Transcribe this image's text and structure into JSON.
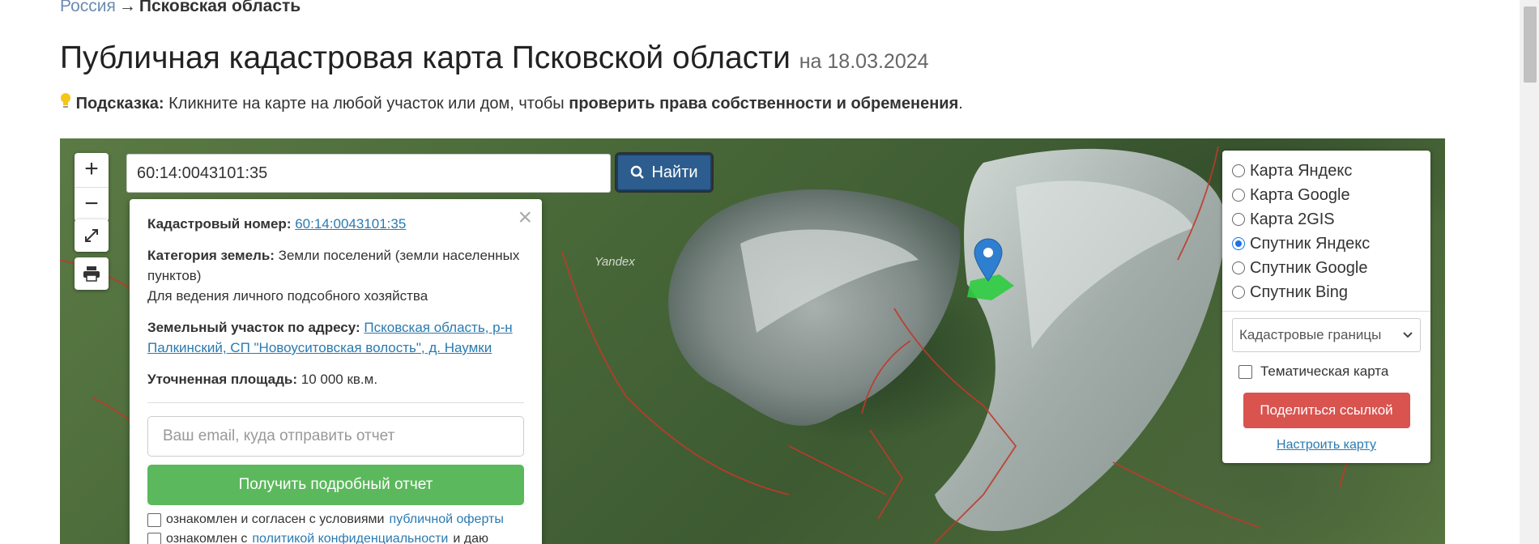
{
  "breadcrumb": {
    "parent": "Россия",
    "separator": "→",
    "current": "Псковская область"
  },
  "title": {
    "main": "Публичная кадастровая карта Псковской области",
    "date": "на 18.03.2024"
  },
  "hint": {
    "label": "Подсказка:",
    "text_before": "Кликните на карте на любой участок или дом, чтобы",
    "bold": "проверить права собственности и обременения",
    "text_after": "."
  },
  "map": {
    "zoom_in": "+",
    "zoom_out": "−",
    "watermark": "Yandex",
    "search": {
      "value": "60:14:0043101:35",
      "button_label": "Найти"
    },
    "popup": {
      "close": "×",
      "cadastral_label": "Кадастровый номер:",
      "cadastral_value": "60:14:0043101:35",
      "category_label": "Категория земель:",
      "category_value": "Земли поселений (земли населенных пунктов)",
      "usage": "Для ведения личного подсобного хозяйства",
      "address_label": "Земельный участок по адресу:",
      "address_value": "Псковская область, р-н Палкинский, СП \"Новоуситовская волость\", д. Наумки",
      "area_label": "Уточненная площадь:",
      "area_value": "10 000 кв.м.",
      "email_placeholder": "Ваш email, куда отправить отчет",
      "report_button": "Получить подробный отчет",
      "agree1_text": "ознакомлен и согласен с условиями",
      "agree1_link": "публичной оферты",
      "agree2_text": "ознакомлен с",
      "agree2_link": "политикой конфиденциальности",
      "agree2_after": "и даю"
    },
    "layers": {
      "options": [
        {
          "label": "Карта Яндекс",
          "checked": false
        },
        {
          "label": "Карта Google",
          "checked": false
        },
        {
          "label": "Карта 2GIS",
          "checked": false
        },
        {
          "label": "Спутник Яндекс",
          "checked": true
        },
        {
          "label": "Спутник Google",
          "checked": false
        },
        {
          "label": "Спутник Bing",
          "checked": false
        }
      ],
      "select_value": "Кадастровые границы",
      "thematic_label": "Тематическая карта",
      "share_button": "Поделиться ссылкой",
      "configure_link": "Настроить карту"
    }
  },
  "colors": {
    "search_button": "#2c5d8e",
    "report_button": "#5cb85c",
    "share_button": "#d9534f",
    "link": "#2a7ab0",
    "boundary": "#c0392b",
    "parcel": "#2ecc40"
  }
}
